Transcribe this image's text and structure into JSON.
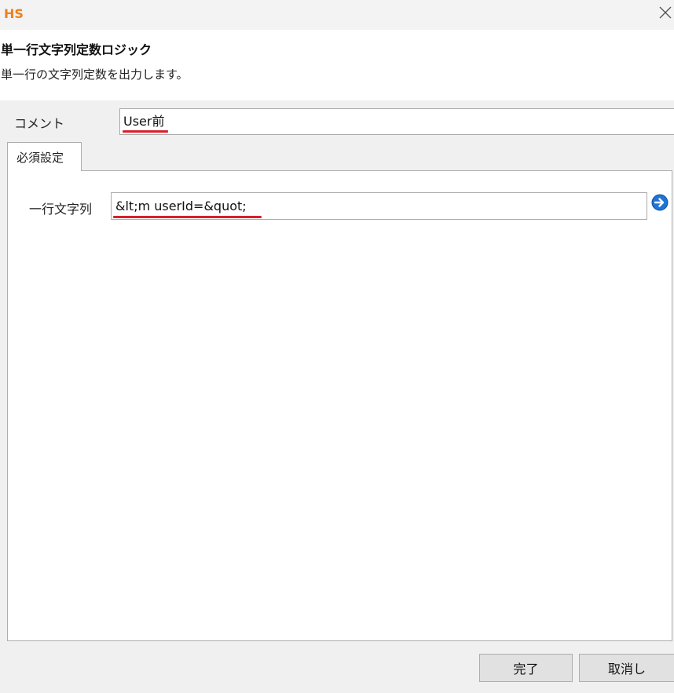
{
  "window": {
    "app_logo": "HS"
  },
  "header": {
    "title": "単一行文字列定数ロジック",
    "description": "単一行の文字列定数を出力します。"
  },
  "comment": {
    "label": "コメント",
    "value": "User前"
  },
  "tabs": [
    {
      "label": "必須設定",
      "selected": true
    }
  ],
  "required_settings": {
    "string_label": "一行文字列",
    "string_value": "&lt;m userId=&quot;"
  },
  "footer": {
    "ok_label": "完了",
    "cancel_label": "取消し"
  },
  "colors": {
    "logo": "#f07e1a",
    "annotation_underline": "#d9202a",
    "arrow_button": "#1f74d6"
  },
  "icons": {
    "close": "close-icon",
    "expand": "arrow-right-circle-icon"
  }
}
